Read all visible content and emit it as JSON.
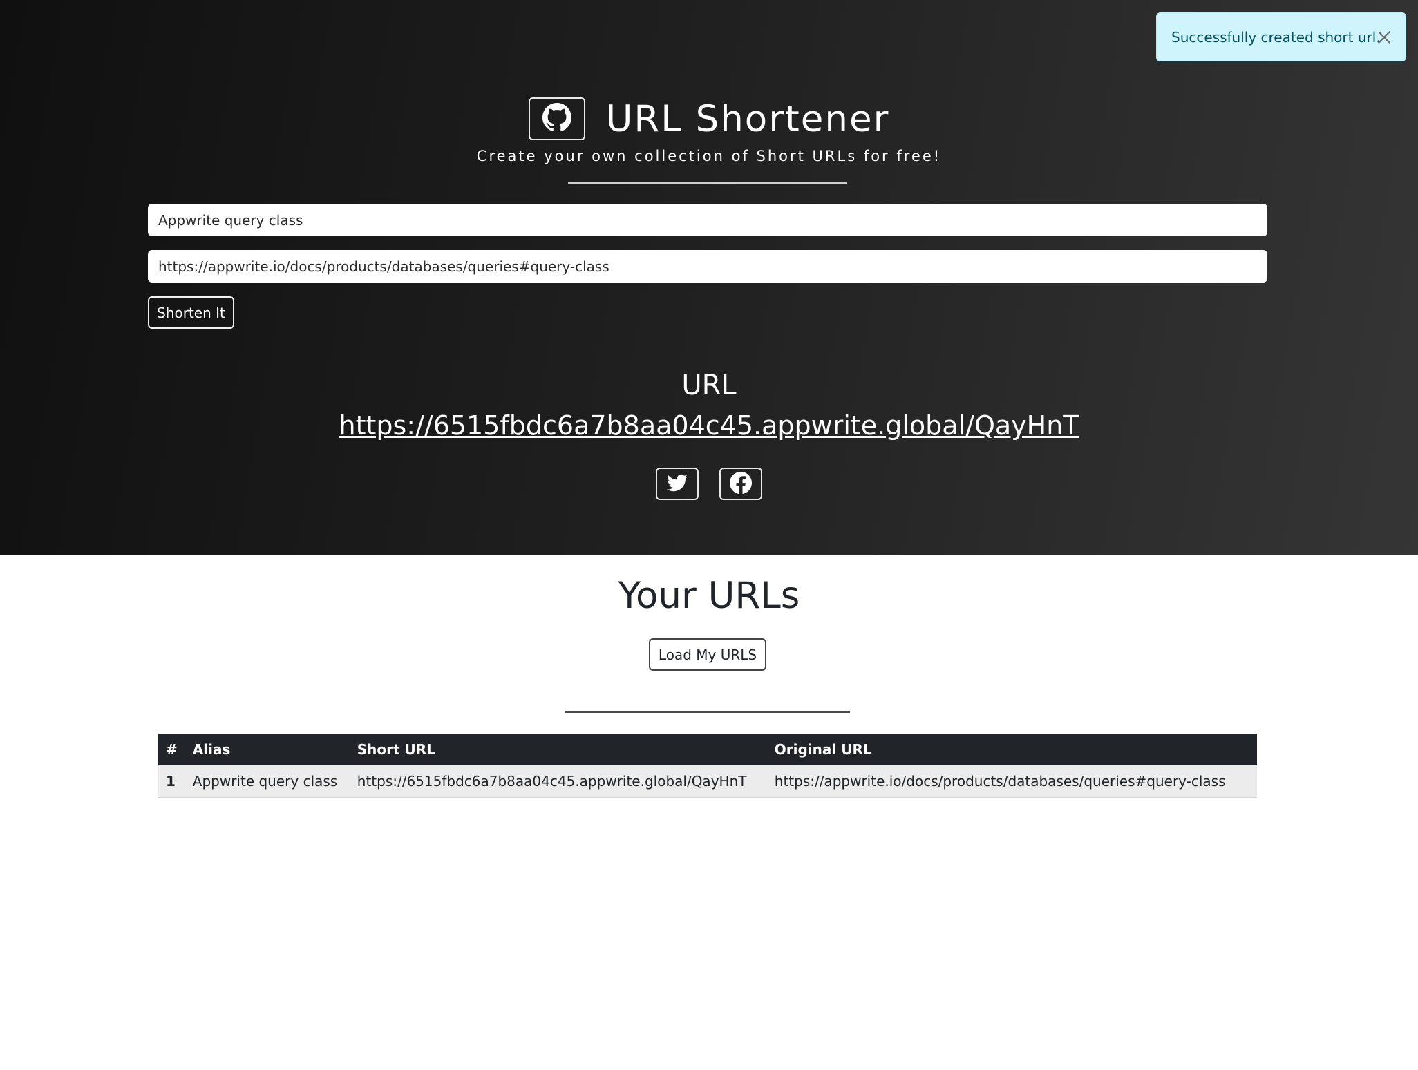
{
  "header": {
    "title": "URL Shortener",
    "subtitle": "Create your own collection of Short URLs for free!",
    "github_icon": "github-icon"
  },
  "form": {
    "alias_value": "Appwrite query class",
    "url_value": "https://appwrite.io/docs/products/databases/queries#query-class",
    "submit_label": "Shorten It"
  },
  "result": {
    "label": "URL",
    "short_url": "https://6515fbdc6a7b8aa04c45.appwrite.global/QayHnT",
    "share_icons": [
      "twitter-icon",
      "facebook-icon"
    ]
  },
  "urls_section": {
    "title": "Your URLs",
    "load_label": "Load My URLS",
    "table": {
      "headers": [
        "#",
        "Alias",
        "Short URL",
        "Original URL"
      ],
      "rows": [
        [
          "1",
          "Appwrite query class",
          "https://6515fbdc6a7b8aa04c45.appwrite.global/QayHnT",
          "https://appwrite.io/docs/products/databases/queries#query-class"
        ]
      ]
    }
  },
  "toast": {
    "message": "Successfully created short url.",
    "close_icon": "close-icon"
  },
  "colors": {
    "hero_dark": "#101010",
    "hero_light": "#353535",
    "table_header": "#212529",
    "toast_bg": "#cff4fc",
    "toast_text": "#055160"
  }
}
